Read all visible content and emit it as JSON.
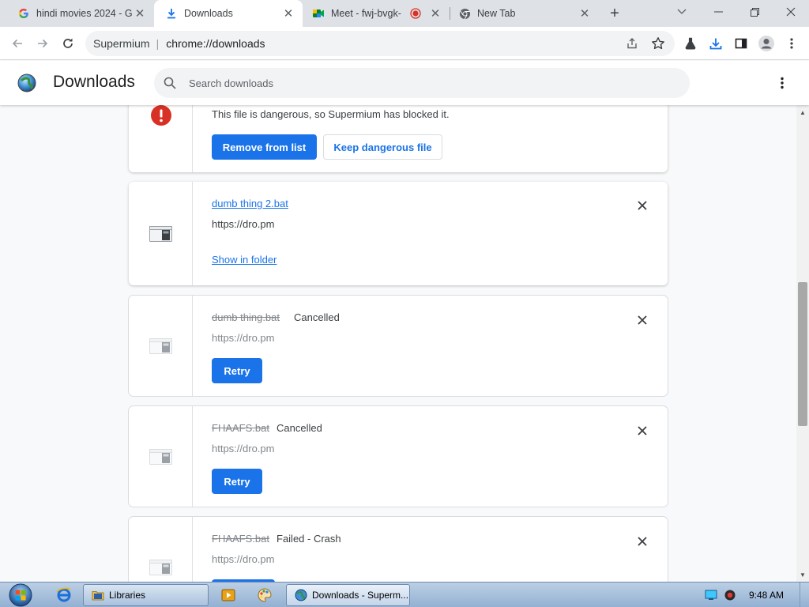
{
  "window": {
    "tabs": [
      {
        "title": "hindi movies 2024 - G",
        "favicon": "google-g-icon",
        "active": false
      },
      {
        "title": "Downloads",
        "favicon": "download-icon",
        "active": true
      },
      {
        "title": "Meet - fwj-bvgk-",
        "favicon": "meet-icon",
        "active": false,
        "recording": true
      },
      {
        "title": "New Tab",
        "favicon": "chrome-icon",
        "active": false
      }
    ]
  },
  "toolbar": {
    "site_label": "Supermium",
    "url": "chrome://downloads"
  },
  "downloads_page": {
    "title": "Downloads",
    "search_placeholder": "Search downloads"
  },
  "items": [
    {
      "type": "dangerous",
      "message": "This file is dangerous, so Supermium has blocked it.",
      "primary_button": "Remove from list",
      "secondary_button": "Keep dangerous file"
    },
    {
      "type": "complete",
      "filename": "dumb thing 2.bat",
      "url": "https://dro.pm",
      "action": "Show in folder"
    },
    {
      "type": "cancelled",
      "filename": "dumb thing.bat",
      "status": "Cancelled",
      "url": "https://dro.pm",
      "button": "Retry"
    },
    {
      "type": "cancelled",
      "filename": "FHAAFS.bat",
      "status": "Cancelled",
      "url": "https://dro.pm",
      "button": "Retry"
    },
    {
      "type": "failed",
      "filename": "FHAAFS.bat",
      "status": "Failed - Crash",
      "url": "https://dro.pm"
    }
  ],
  "taskbar": {
    "items": [
      {
        "label": "Libraries",
        "icon": "folder-icon"
      },
      {
        "label": "Downloads - Superm...",
        "icon": "supermium-icon",
        "active": true
      }
    ],
    "clock": "9:48 AM"
  },
  "colors": {
    "accent": "#1a73e8",
    "danger": "#d93025",
    "tabstrip": "#dee1e6"
  }
}
